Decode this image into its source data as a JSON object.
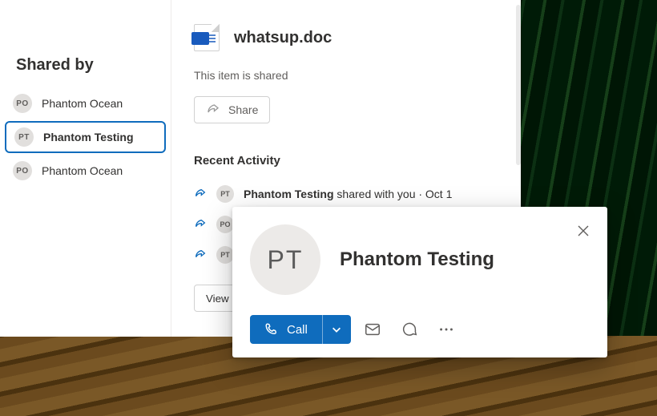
{
  "sidebar": {
    "title": "Shared by",
    "items": [
      {
        "initials": "PO",
        "label": "Phantom Ocean"
      },
      {
        "initials": "PT",
        "label": "Phantom Testing"
      },
      {
        "initials": "PO",
        "label": "Phantom Ocean"
      }
    ],
    "selected_index": 1
  },
  "details": {
    "file_name": "whatsup.doc",
    "shared_status": "This item is shared",
    "share_button_label": "Share",
    "recent_activity_title": "Recent Activity",
    "activity": [
      {
        "initials": "PT",
        "actor": "Phantom Testing",
        "text": " shared with you · Oct 1"
      },
      {
        "initials": "PO",
        "actor": "",
        "text": ""
      },
      {
        "initials": "PT",
        "actor": "",
        "text": ""
      }
    ],
    "view_button_label": "View"
  },
  "contact": {
    "initials": "PT",
    "name": "Phantom Testing",
    "call_label": "Call"
  },
  "colors": {
    "primary": "#0f6cbd"
  }
}
